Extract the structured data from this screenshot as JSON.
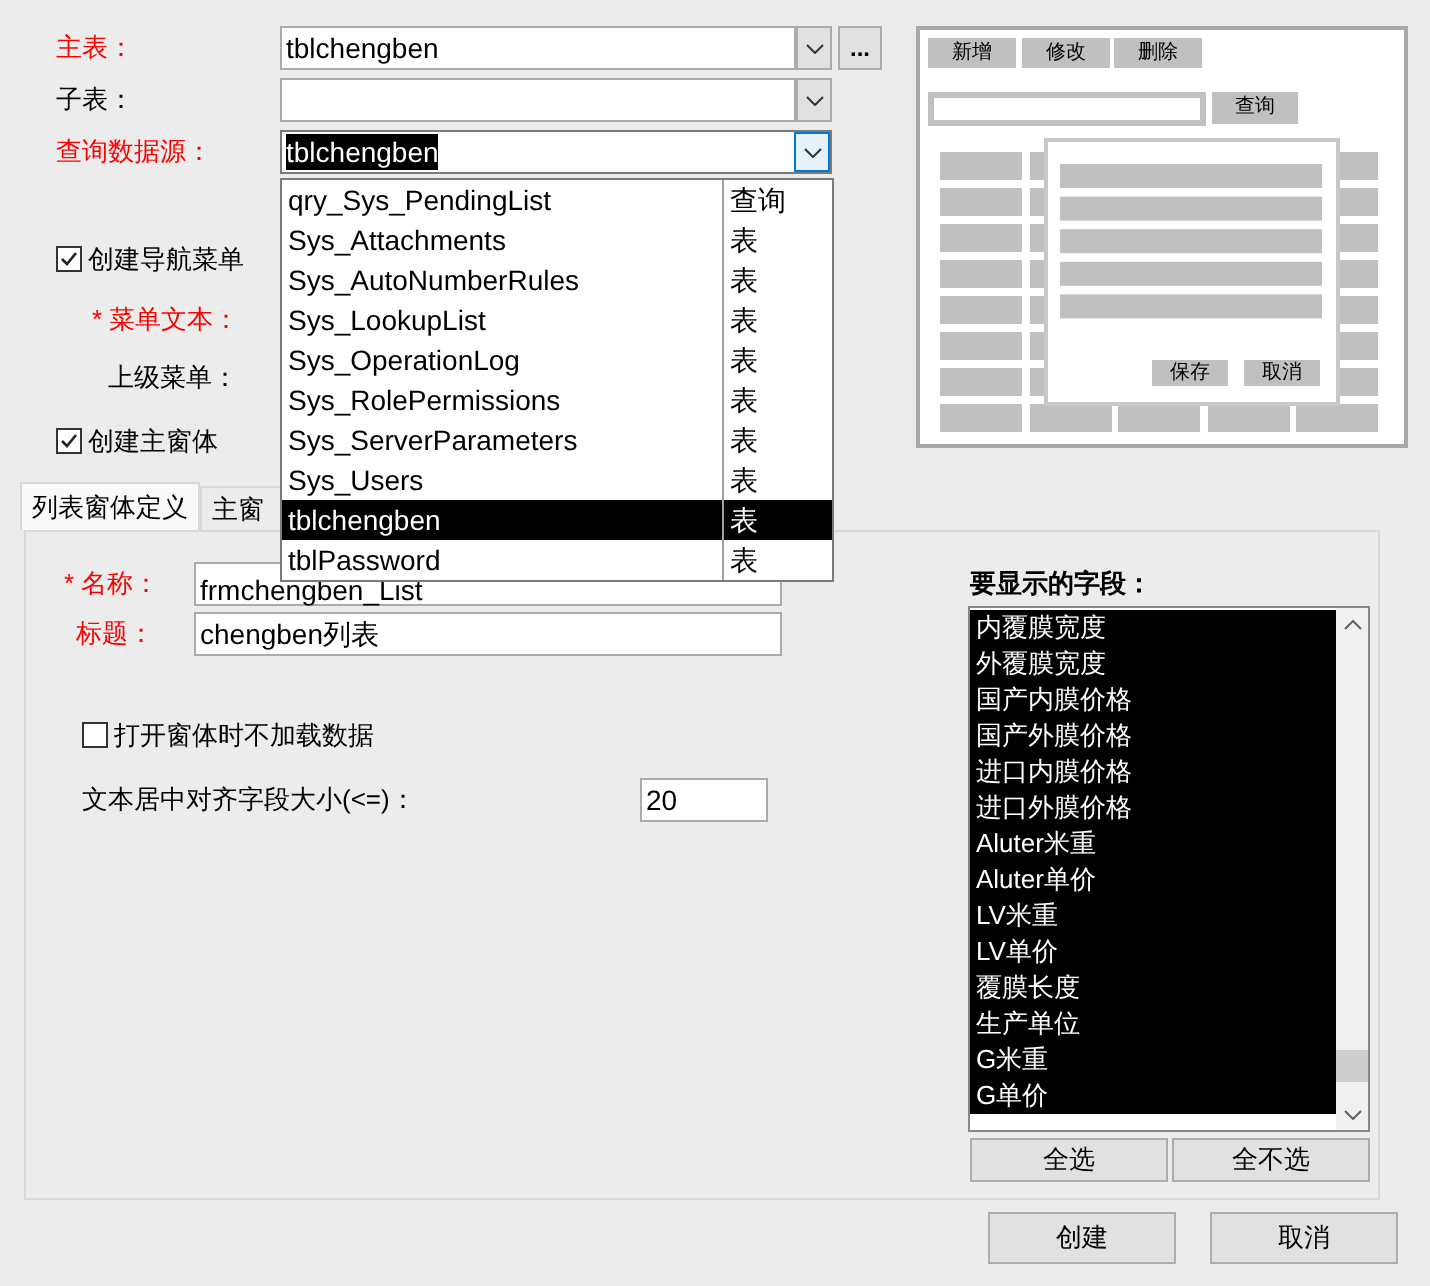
{
  "source_fields": [
    {
      "label": "主表：",
      "required": true,
      "value": "tblchengben",
      "focused": false,
      "browse_button": "..."
    },
    {
      "label": "子表：",
      "required": false,
      "focused": false
    },
    {
      "label": "查询数据源：",
      "required": true,
      "value": "tblchengben",
      "focused": true
    }
  ],
  "dropdown": [
    {
      "name": "qry_Sys_PendingList",
      "type": "查询",
      "selected": false
    },
    {
      "name": "Sys_Attachments",
      "type": "表",
      "selected": false
    },
    {
      "name": "Sys_AutoNumberRules",
      "type": "表",
      "selected": false
    },
    {
      "name": "Sys_LookupList",
      "type": "表",
      "selected": false
    },
    {
      "name": "Sys_OperationLog",
      "type": "表",
      "selected": false
    },
    {
      "name": "Sys_RolePermissions",
      "type": "表",
      "selected": false
    },
    {
      "name": "Sys_ServerParameters",
      "type": "表",
      "selected": false
    },
    {
      "name": "Sys_Users",
      "type": "表",
      "selected": false
    },
    {
      "name": "tblchengben",
      "type": "表",
      "selected": true
    },
    {
      "name": "tblPassword",
      "type": "表",
      "selected": false
    }
  ],
  "create_nav_menu": {
    "label": "创建导航菜单",
    "checked": true
  },
  "menu_text": {
    "label": "* 菜单文本：",
    "required": true
  },
  "parent_menu": {
    "label": "上级菜单：",
    "required": false
  },
  "create_main_form": {
    "label": "创建主窗体",
    "checked": true
  },
  "preview": {
    "toolbar": [
      "新增",
      "修改",
      "删除"
    ],
    "search_button": "查询",
    "dialog_buttons": [
      "保存",
      "取消"
    ]
  },
  "tabs": [
    {
      "label": "列表窗体定义",
      "selected": true
    },
    {
      "label": "主窗",
      "selected": false
    }
  ],
  "list_form": {
    "fields": [
      {
        "label": "* 名称：",
        "required": true,
        "value": "frmchengben_List"
      },
      {
        "label": "标题：",
        "required": true,
        "value": "chengben列表"
      }
    ],
    "no_load_on_open": {
      "label": "打开窗体时不加载数据",
      "checked": false
    },
    "center_align_size": {
      "label": "文本居中对齐字段大小(<=)：",
      "value": "20"
    },
    "display_fields_label": "要显示的字段：",
    "display_fields": [
      {
        "name": "内覆膜宽度",
        "selected": true
      },
      {
        "name": "外覆膜宽度",
        "selected": true
      },
      {
        "name": "国产内膜价格",
        "selected": true
      },
      {
        "name": "国产外膜价格",
        "selected": true
      },
      {
        "name": "进口内膜价格",
        "selected": true
      },
      {
        "name": "进口外膜价格",
        "selected": true
      },
      {
        "name": "Aluter米重",
        "selected": true
      },
      {
        "name": "Aluter单价",
        "selected": true
      },
      {
        "name": "LV米重",
        "selected": true
      },
      {
        "name": "LV单价",
        "selected": true
      },
      {
        "name": "覆膜长度",
        "selected": true
      },
      {
        "name": "生产单位",
        "selected": true
      },
      {
        "name": "G米重",
        "selected": true
      },
      {
        "name": "G单价",
        "selected": true
      }
    ],
    "select_buttons": [
      "全选",
      "全不选"
    ]
  },
  "buttons": [
    "创建",
    "取消"
  ]
}
